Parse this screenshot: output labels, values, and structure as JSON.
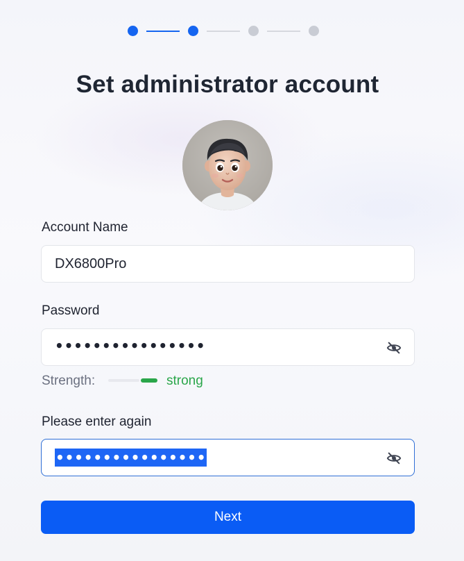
{
  "stepper": {
    "total_steps": 4,
    "current_step": 2,
    "active_color": "#1565f0",
    "inactive_color": "#c9ccd4"
  },
  "title": "Set administrator account",
  "avatar": {
    "icon": "user-avatar-3d-portrait"
  },
  "account": {
    "label": "Account Name",
    "value": "DX6800Pro"
  },
  "password": {
    "label": "Password",
    "value_masked": "••••••••••••••••",
    "toggle_icon": "eye-off-icon"
  },
  "strength": {
    "label": "Strength:",
    "value": "strong",
    "color": "#2aa64a"
  },
  "confirm": {
    "label": "Please enter again",
    "value_masked": "••••••••••••••••",
    "toggle_icon": "eye-off-icon",
    "selected": true
  },
  "next_button": {
    "label": "Next",
    "color": "#0a5cf5"
  }
}
